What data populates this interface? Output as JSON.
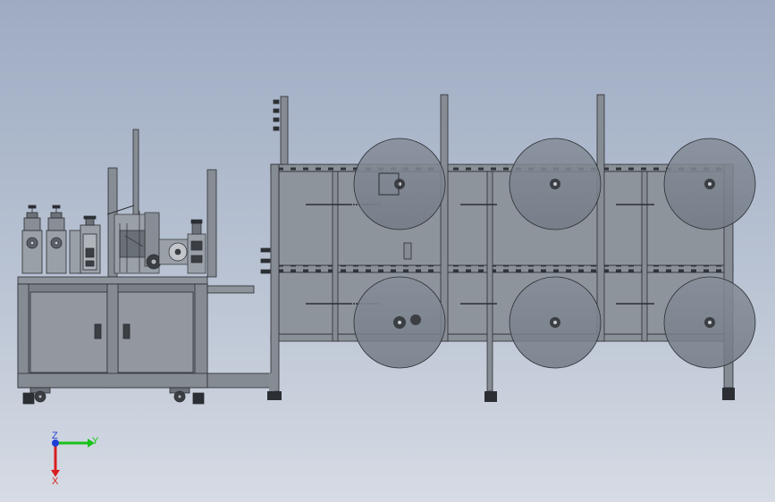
{
  "view": {
    "background_top": "#9eabc2",
    "background_bottom": "#d6dbe4"
  },
  "machine": {
    "frame_color": "#7e848c",
    "panel_color": "#8e949c",
    "panel_dark": "#6f757d",
    "disc_color": "#7d8590",
    "outline_color": "#2b2e33",
    "unwind_rolls": 6
  },
  "triad": {
    "y_label": "Y",
    "x_label": "X",
    "z_label": "Z",
    "y_color": "#19c219",
    "x_color": "#d81e1e",
    "z_color": "#1f3fd8"
  }
}
